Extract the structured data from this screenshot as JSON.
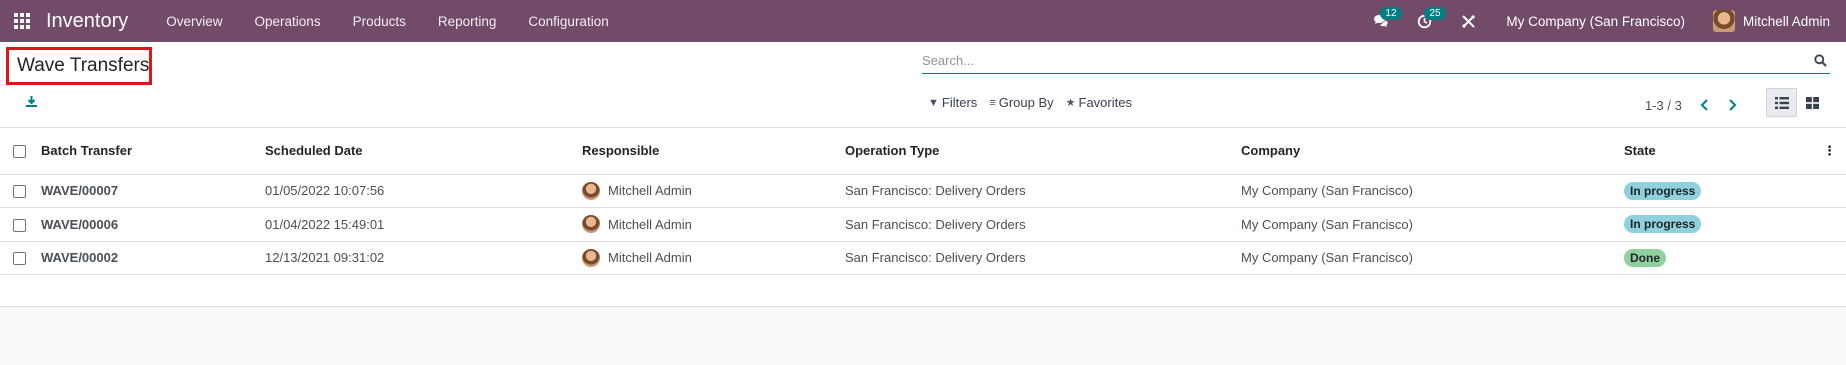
{
  "navbar": {
    "app_name": "Inventory",
    "menu": [
      "Overview",
      "Operations",
      "Products",
      "Reporting",
      "Configuration"
    ],
    "messages_count": "12",
    "activities_count": "25",
    "company": "My Company (San Francisco)",
    "user": "Mitchell Admin",
    "accent_color": "#714b67"
  },
  "control_panel": {
    "title": "Wave Transfers",
    "search_placeholder": "Search...",
    "filters_label": "Filters",
    "group_by_label": "Group By",
    "favorites_label": "Favorites",
    "pager_value": "1-3 / 3"
  },
  "table": {
    "columns": [
      "Batch Transfer",
      "Scheduled Date",
      "Responsible",
      "Operation Type",
      "Company",
      "State"
    ],
    "rows": [
      {
        "ref": "WAVE/00007",
        "date": "01/05/2022 10:07:56",
        "responsible": "Mitchell Admin",
        "operation_type": "San Francisco: Delivery Orders",
        "company": "My Company (San Francisco)",
        "state": "In progress",
        "state_color": "#8fd1dc"
      },
      {
        "ref": "WAVE/00006",
        "date": "01/04/2022 15:49:01",
        "responsible": "Mitchell Admin",
        "operation_type": "San Francisco: Delivery Orders",
        "company": "My Company (San Francisco)",
        "state": "In progress",
        "state_color": "#8fd1dc"
      },
      {
        "ref": "WAVE/00002",
        "date": "12/13/2021 09:31:02",
        "responsible": "Mitchell Admin",
        "operation_type": "San Francisco: Delivery Orders",
        "company": "My Company (San Francisco)",
        "state": "Done",
        "state_color": "#8fd19e"
      }
    ]
  }
}
